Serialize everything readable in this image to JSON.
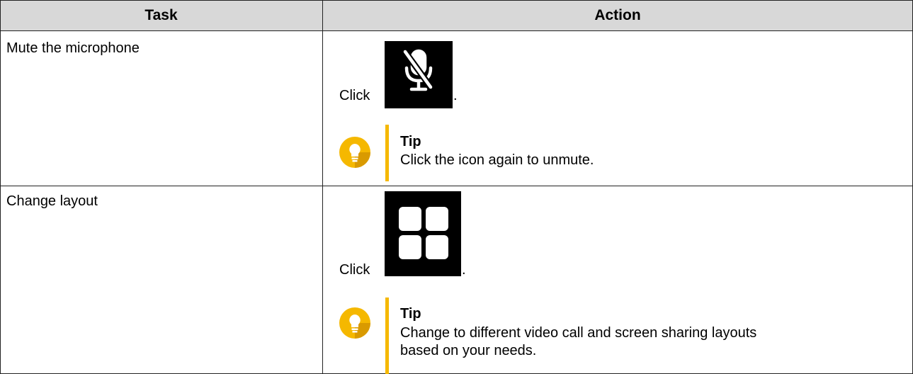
{
  "table": {
    "headers": {
      "task": "Task",
      "action": "Action"
    },
    "rows": [
      {
        "task": "Mute the microphone",
        "click_prefix": "Click",
        "click_suffix": ".",
        "icon": "microphone-muted-icon",
        "tip_title": "Tip",
        "tip_text": "Click the icon again to unmute."
      },
      {
        "task": "Change layout",
        "click_prefix": "Click",
        "click_suffix": ".",
        "icon": "grid-layout-icon",
        "tip_title": "Tip",
        "tip_text": "Change to different video call and screen sharing layouts based on your needs."
      }
    ]
  },
  "colors": {
    "header_bg": "#d8d8d8",
    "tip_accent": "#f5b800",
    "icon_bg": "#000000"
  }
}
